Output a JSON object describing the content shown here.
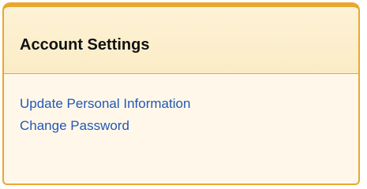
{
  "panel": {
    "title": "Account Settings",
    "links": [
      {
        "label": "Update Personal Information"
      },
      {
        "label": "Change Password"
      }
    ]
  },
  "colors": {
    "border": "#e8a830",
    "header_bg": "#fcefd0",
    "body_bg": "#fff8ea",
    "link": "#2257b6",
    "title": "#111111"
  }
}
